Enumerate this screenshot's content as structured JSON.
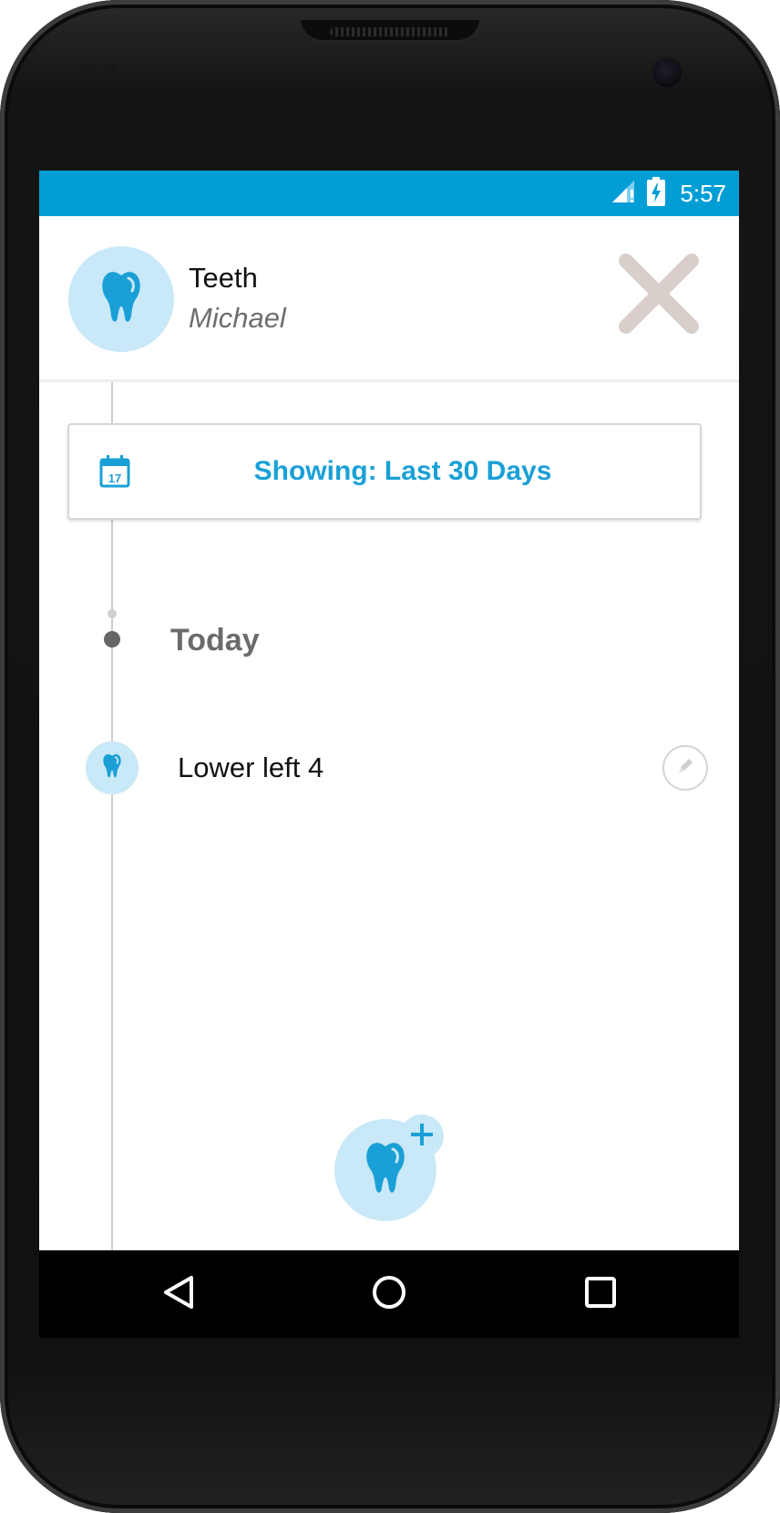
{
  "status_bar": {
    "time": "5:57",
    "icons": [
      "signal-icon",
      "battery-charging-icon"
    ],
    "background": "#019ed6"
  },
  "header": {
    "title": "Teeth",
    "subtitle": "Michael",
    "icon": "tooth-icon",
    "close_icon": "close-icon"
  },
  "filter": {
    "icon": "calendar-icon",
    "calendar_day": "17",
    "label": "Showing: Last 30 Days"
  },
  "timeline": {
    "groups": [
      {
        "heading": "Today",
        "entries": [
          {
            "label": "Lower left 4",
            "icon": "tooth-icon",
            "action_icon": "edit-icon"
          }
        ]
      }
    ]
  },
  "fab": {
    "icon": "add-tooth-icon"
  },
  "nav_bar": {
    "buttons": [
      "back-icon",
      "home-icon",
      "recents-icon"
    ]
  },
  "colors": {
    "accent": "#1aa0d6",
    "light_accent": "#c9e8f8",
    "close": "#d8cfca"
  }
}
